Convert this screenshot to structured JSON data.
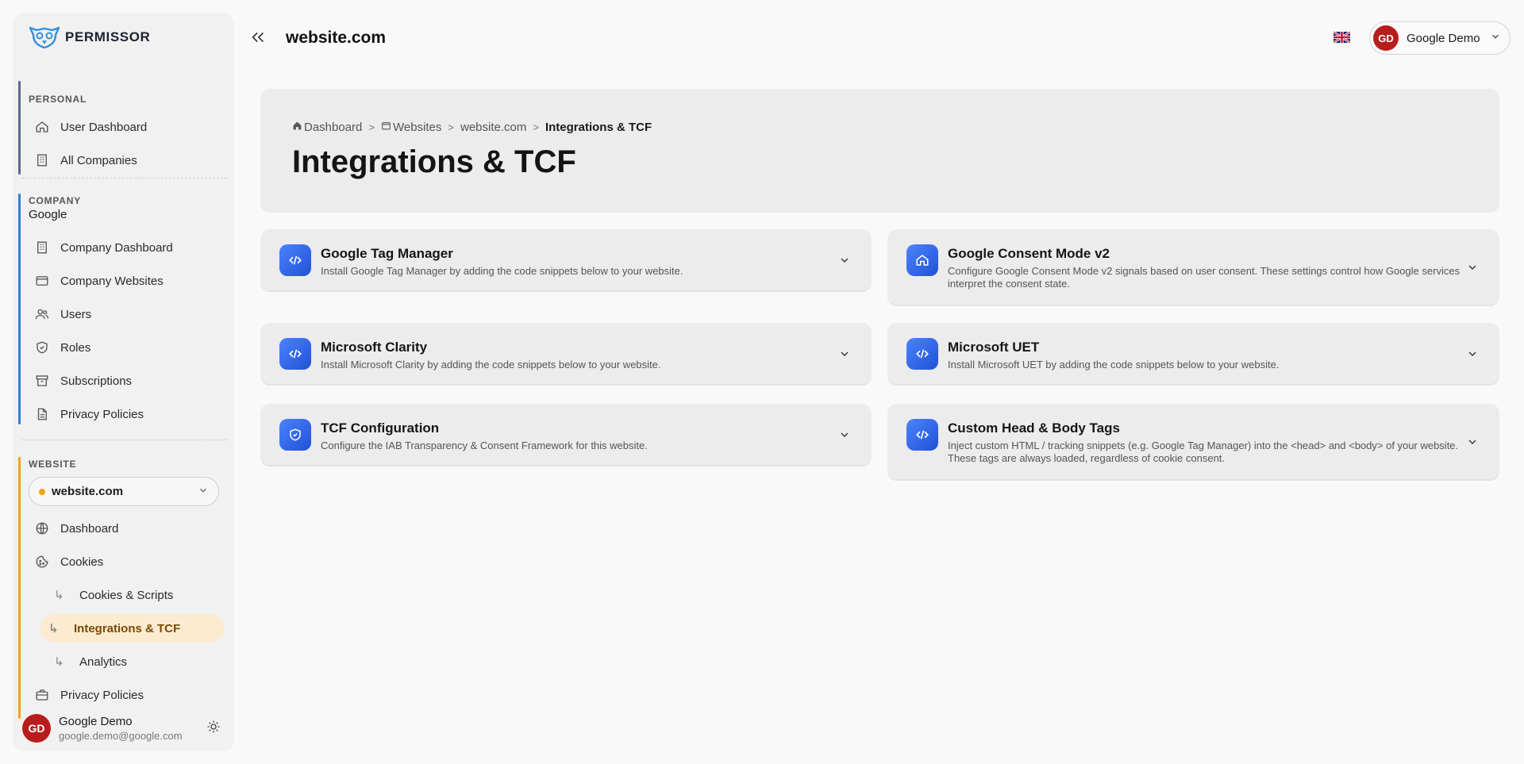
{
  "brand": {
    "name": "PERMISSOR"
  },
  "sidebar": {
    "personal": {
      "label": "PERSONAL",
      "items": [
        {
          "label": "User Dashboard",
          "icon": "home-icon"
        },
        {
          "label": "All Companies",
          "icon": "building-icon"
        }
      ]
    },
    "company": {
      "label": "COMPANY",
      "name": "Google",
      "items": [
        {
          "label": "Company Dashboard",
          "icon": "building-icon"
        },
        {
          "label": "Company Websites",
          "icon": "browser-icon"
        },
        {
          "label": "Users",
          "icon": "users-icon"
        },
        {
          "label": "Roles",
          "icon": "shield-icon"
        },
        {
          "label": "Subscriptions",
          "icon": "archive-icon"
        },
        {
          "label": "Privacy Policies",
          "icon": "document-icon"
        }
      ]
    },
    "website": {
      "label": "WEBSITE",
      "selected_site": "website.com",
      "items": [
        {
          "label": "Dashboard",
          "icon": "globe-icon"
        },
        {
          "label": "Cookies",
          "icon": "cookie-icon"
        },
        {
          "label": "Cookies & Scripts",
          "sub": true
        },
        {
          "label": "Integrations & TCF",
          "sub": true,
          "active": true
        },
        {
          "label": "Analytics",
          "sub": true
        },
        {
          "label": "Privacy Policies",
          "icon": "briefcase-icon"
        }
      ]
    },
    "user": {
      "initials": "GD",
      "name": "Google Demo",
      "email": "google.demo@google.com"
    }
  },
  "header": {
    "site_title": "website.com",
    "user_initials": "GD",
    "user_name": "Google Demo"
  },
  "breadcrumb": {
    "dashboard": "Dashboard",
    "websites": "Websites",
    "site": "website.com",
    "current": "Integrations & TCF"
  },
  "page": {
    "title": "Integrations & TCF"
  },
  "cards": {
    "gtm": {
      "title": "Google Tag Manager",
      "desc": "Install Google Tag Manager by adding the code snippets below to your website."
    },
    "gcm": {
      "title": "Google Consent Mode v2",
      "desc": "Configure Google Consent Mode v2 signals based on user consent. These settings control how Google services interpret the consent state."
    },
    "clarity": {
      "title": "Microsoft Clarity",
      "desc": "Install Microsoft Clarity by adding the code snippets below to your website."
    },
    "uet": {
      "title": "Microsoft UET",
      "desc": "Install Microsoft UET by adding the code snippets below to your website."
    },
    "tcf": {
      "title": "TCF Configuration",
      "desc": "Configure the IAB Transparency & Consent Framework for this website."
    },
    "custom": {
      "title": "Custom Head & Body Tags",
      "desc": "Inject custom HTML / tracking snippets (e.g. Google Tag Manager) into the <head> and <body> of your website. These tags are always loaded, regardless of cookie consent."
    }
  },
  "colors": {
    "accent_blue": "#2f62e8",
    "personal_bar": "#5a6a8a",
    "company_bar": "#2b7fd6",
    "website_bar": "#f2a20a",
    "avatar_red": "#b91c1c",
    "active_bg": "#fdebd1"
  }
}
